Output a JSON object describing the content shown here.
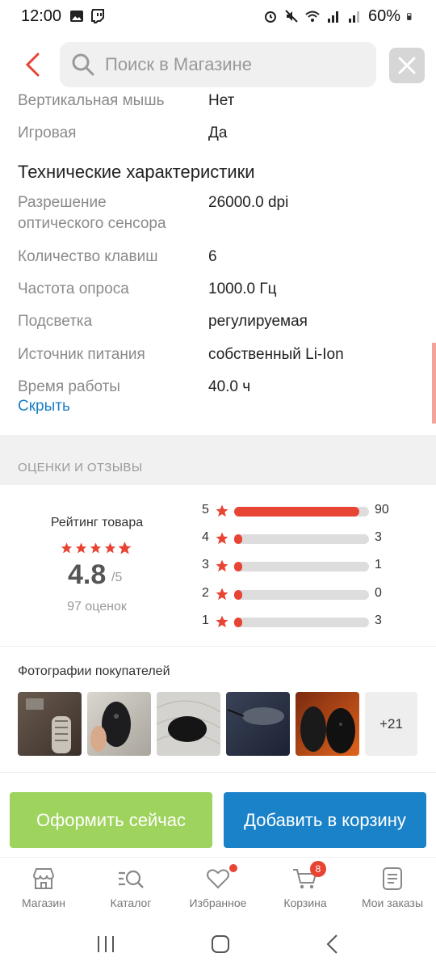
{
  "status_bar": {
    "time": "12:00",
    "battery": "60%"
  },
  "search": {
    "placeholder": "Поиск в Магазине",
    "value": ""
  },
  "specs": {
    "partial_rows": [
      {
        "key": "Вертикальная мышь",
        "value": "Нет"
      },
      {
        "key": "Игровая",
        "value": "Да"
      }
    ],
    "section_title": "Технические характеристики",
    "rows": [
      {
        "key": "Разрешение оптического сенсора",
        "value": "26000.0 dpi"
      },
      {
        "key": "Количество клавиш",
        "value": "6"
      },
      {
        "key": "Частота опроса",
        "value": "1000.0 Гц"
      },
      {
        "key": "Подсветка",
        "value": "регулируемая"
      },
      {
        "key": "Источник питания",
        "value": "собственный Li-Ion"
      },
      {
        "key": "Время работы",
        "value": "40.0 ч"
      }
    ],
    "hide_label": "Скрыть"
  },
  "reviews": {
    "heading": "ОЦЕНКИ И ОТЗЫВЫ",
    "rating_title": "Рейтинг товара",
    "score": "4.8",
    "score_max": "/5",
    "count_label": "97 оценок",
    "stars_filled": 4.8,
    "distribution": [
      {
        "stars": "5",
        "count": "90",
        "fraction": 0.93
      },
      {
        "stars": "4",
        "count": "3",
        "fraction": 0.03
      },
      {
        "stars": "3",
        "count": "1",
        "fraction": 0.01
      },
      {
        "stars": "2",
        "count": "0",
        "fraction": 0.0
      },
      {
        "stars": "1",
        "count": "3",
        "fraction": 0.03
      }
    ]
  },
  "photos": {
    "title": "Фотографии покупателей",
    "more_label": "+21"
  },
  "actions": {
    "buy_now": "Оформить сейчас",
    "add_to_cart": "Добавить в корзину"
  },
  "bottom_nav": {
    "items": [
      {
        "label": "Магазин",
        "icon": "store-icon"
      },
      {
        "label": "Каталог",
        "icon": "catalog-search-icon"
      },
      {
        "label": "Избранное",
        "icon": "heart-icon"
      },
      {
        "label": "Корзина",
        "icon": "cart-icon",
        "badge": "8"
      },
      {
        "label": "Мои заказы",
        "icon": "orders-icon"
      }
    ]
  },
  "colors": {
    "accent_red": "#e84434",
    "link_blue": "#1a7fc4",
    "buy_green": "#9ed35d",
    "cart_blue": "#1a82c9"
  }
}
